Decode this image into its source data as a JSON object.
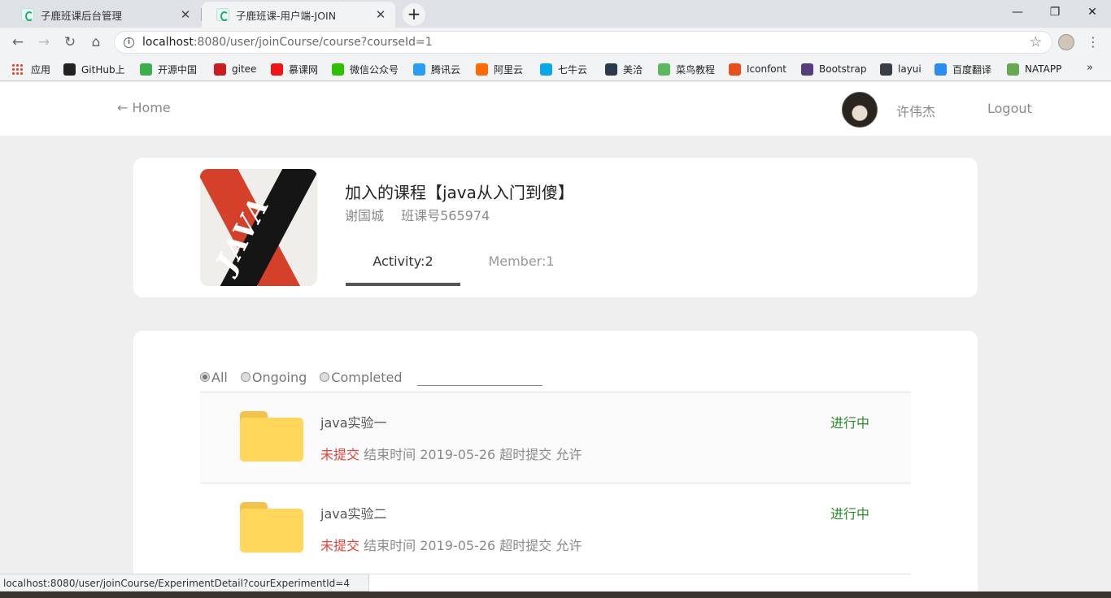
{
  "browser": {
    "tabs": [
      {
        "title": "子鹿班课后台管理",
        "close": "✕"
      },
      {
        "title": "子鹿班课-用户端-JOIN",
        "close": "✕"
      }
    ],
    "new_tab": "+",
    "window_controls": {
      "minimize": "—",
      "maximize": "❐",
      "close": "✕"
    },
    "url_host": "localhost",
    "url_path": ":8080/user/joinCourse/course?courseId=1",
    "bookmarks": [
      {
        "label": "应用",
        "icon": "apps-grid-icon",
        "color": "#e34b2f"
      },
      {
        "label": "GitHub上",
        "icon": "github-icon",
        "color": "#222222"
      },
      {
        "label": "开源中国",
        "icon": "oschina-icon",
        "color": "#3bb04a"
      },
      {
        "label": "gitee",
        "icon": "gitee-icon",
        "color": "#c71d23"
      },
      {
        "label": "慕课网",
        "icon": "imooc-flame-icon",
        "color": "#f01414"
      },
      {
        "label": "微信公众号",
        "icon": "wechat-icon",
        "color": "#2dc100"
      },
      {
        "label": "腾讯云",
        "icon": "tencent-cloud-icon",
        "color": "#2a9df4"
      },
      {
        "label": "阿里云",
        "icon": "aliyun-icon",
        "color": "#ff6a00"
      },
      {
        "label": "七牛云",
        "icon": "qiniu-icon",
        "color": "#0aa6e8"
      },
      {
        "label": "美洽",
        "icon": "meiqia-icon",
        "color": "#2b3a4a"
      },
      {
        "label": "菜鸟教程",
        "icon": "runoob-icon",
        "color": "#5cb85c"
      },
      {
        "label": "Iconfont",
        "icon": "iconfont-icon",
        "color": "#e94e1b"
      },
      {
        "label": "Bootstrap",
        "icon": "bootstrap-icon",
        "color": "#563d7c"
      },
      {
        "label": "layui",
        "icon": "layui-icon",
        "color": "#393d49"
      },
      {
        "label": "百度翻译",
        "icon": "baidu-translate-icon",
        "color": "#2a8cf0"
      },
      {
        "label": "NATAPP",
        "icon": "natapp-icon",
        "color": "#6aa84f"
      }
    ],
    "bookmarks_more": "»",
    "status_url": "localhost:8080/user/joinCourse/ExperimentDetail?courExperimentId=4"
  },
  "nav": {
    "home": "← Home",
    "username": "许伟杰",
    "logout": "Logout"
  },
  "course": {
    "title": "加入的课程【java从入门到傻】",
    "teacher": "谢国城",
    "class_code": "班课号565974",
    "cover_text": "JAVA",
    "tabs": {
      "activity": "Activity:2",
      "member": "Member:1"
    }
  },
  "filters": {
    "options": [
      "All",
      "Ongoing",
      "Completed"
    ],
    "selected": "All"
  },
  "experiments": [
    {
      "title": "java实验一",
      "status": "进行中",
      "submission": "未提交",
      "detail": "结束时间 2019-05-26 超时提交 允许"
    },
    {
      "title": "java实验二",
      "status": "进行中",
      "submission": "未提交",
      "detail": "结束时间 2019-05-26 超时提交 允许"
    }
  ],
  "colors": {
    "status_green": "#2a8a2a",
    "unsubmitted_red": "#e0443a",
    "folder_yellow": "#ffd75a"
  }
}
